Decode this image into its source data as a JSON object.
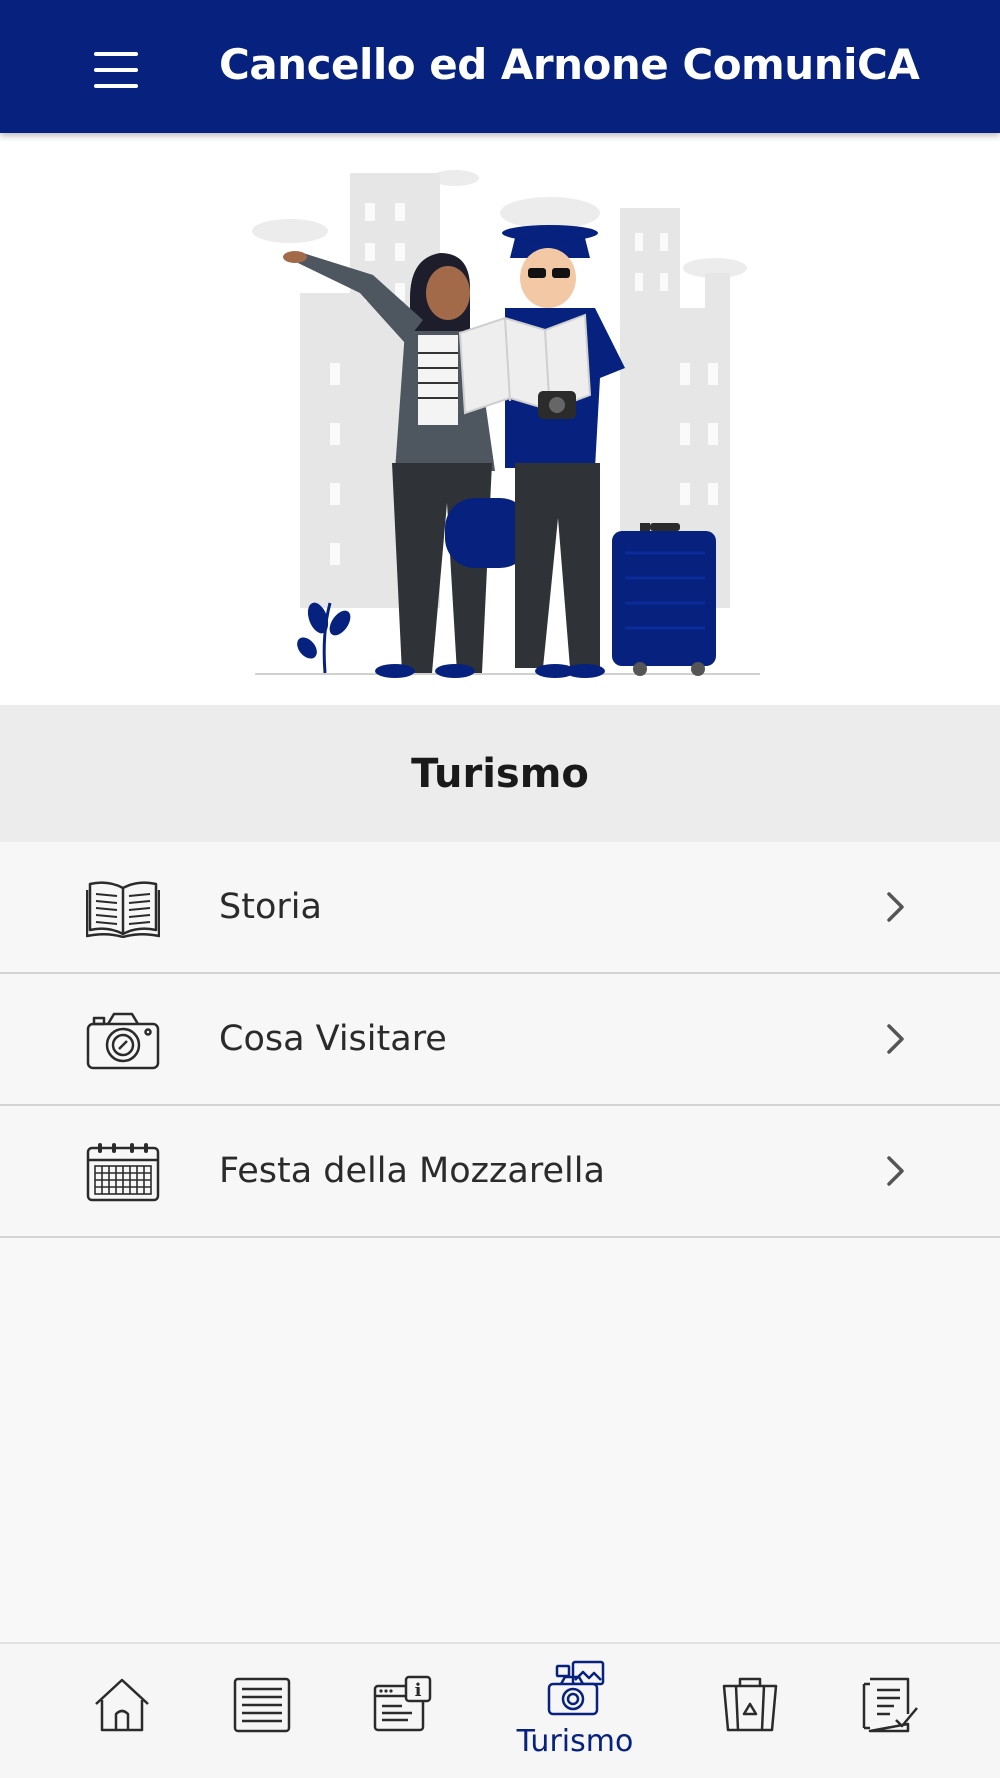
{
  "appbar": {
    "title": "Cancello ed Arnone ComuniCA",
    "menu_icon": "hamburger-menu-icon",
    "background": "#06217e"
  },
  "hero": {
    "illustration": "tourists-with-map-illustration"
  },
  "section": {
    "title": "Turismo"
  },
  "menu": {
    "items": [
      {
        "label": "Storia",
        "icon": "open-book-icon"
      },
      {
        "label": "Cosa Visitare",
        "icon": "camera-icon"
      },
      {
        "label": "Festa della Mozzarella",
        "icon": "calendar-icon"
      }
    ],
    "chevron_icon": "chevron-right-icon"
  },
  "bottom_nav": {
    "items": [
      {
        "icon": "home-icon",
        "label": ""
      },
      {
        "icon": "list-icon",
        "label": ""
      },
      {
        "icon": "news-info-icon",
        "label": ""
      },
      {
        "icon": "camera-gallery-icon",
        "label": "Turismo",
        "active": true
      },
      {
        "icon": "recycle-bin-icon",
        "label": ""
      },
      {
        "icon": "checklist-icon",
        "label": ""
      }
    ],
    "active_color": "#06217e"
  },
  "colors": {
    "primary": "#06217e",
    "list_background": "#f7f7f7",
    "section_background": "#ececec"
  }
}
